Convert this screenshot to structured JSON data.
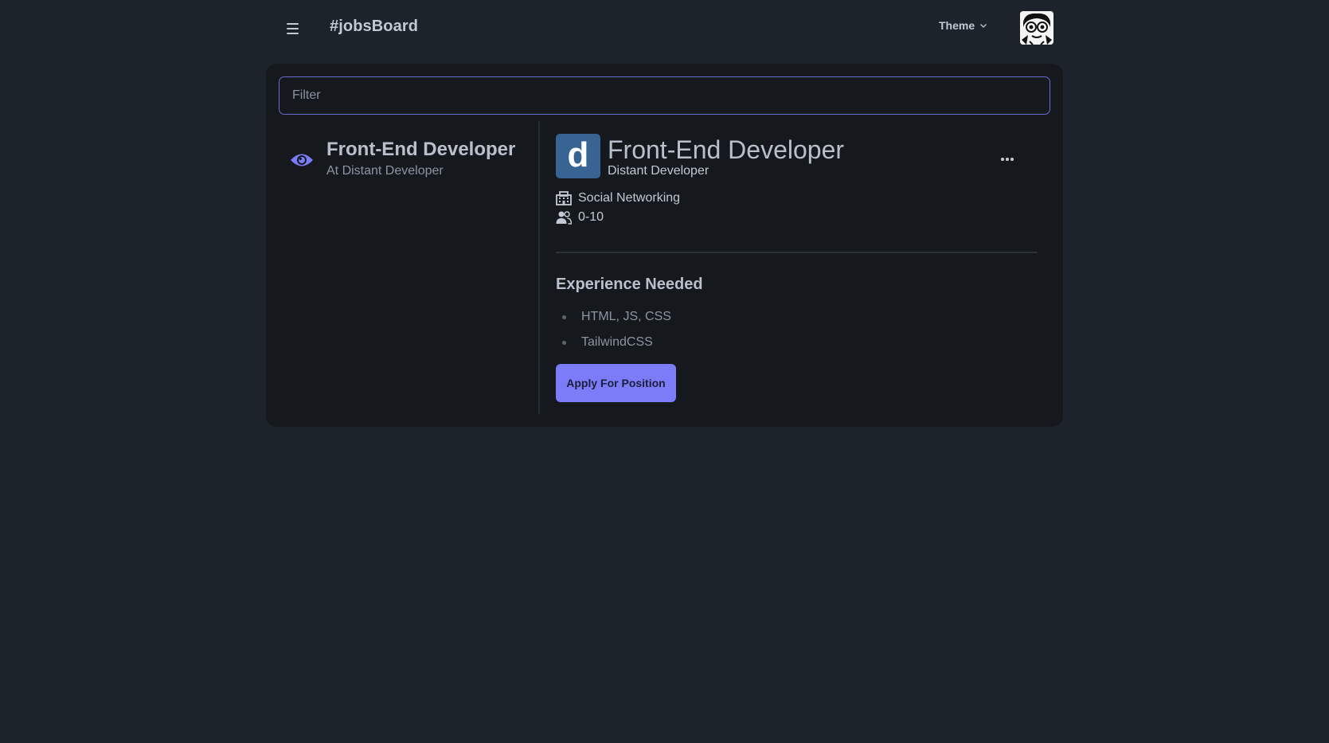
{
  "navbar": {
    "brand": "#jobsBoard",
    "theme_label": "Theme"
  },
  "filter": {
    "placeholder": "Filter"
  },
  "job_list": [
    {
      "title": "Front-End Developer",
      "subtitle": "At Distant Developer"
    }
  ],
  "detail": {
    "logo_letter": "d",
    "title": "Front-End Developer",
    "company": "Distant Developer",
    "industry": "Social Networking",
    "company_size": "0-10",
    "experience_heading": "Experience Needed",
    "experience": [
      "HTML, JS, CSS",
      "TailwindCSS"
    ],
    "apply_label": "Apply For Position"
  },
  "colors": {
    "background": "#1d232a",
    "card": "#15191e",
    "accent": "#7c7cf8",
    "logo_bg": "#386494"
  },
  "icons": {
    "menu": "hamburger-icon",
    "theme": "chevron-down-icon",
    "viewed": "eye-icon",
    "industry": "building-icon",
    "size": "users-icon",
    "more": "ellipsis-icon"
  }
}
